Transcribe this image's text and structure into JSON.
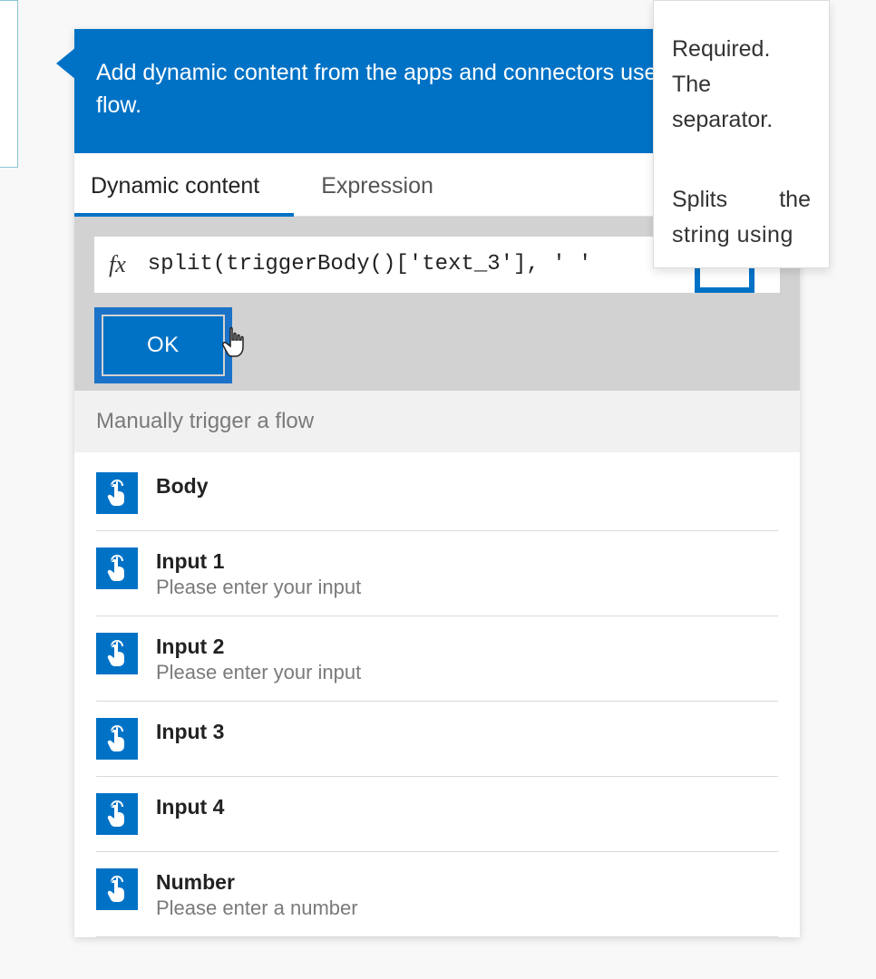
{
  "colors": {
    "primary": "#0072c6"
  },
  "header": {
    "text": "Add dynamic content from the apps and connectors used in this flow."
  },
  "tabs": [
    {
      "label": "Dynamic content",
      "active": true
    },
    {
      "label": "Expression",
      "active": false
    }
  ],
  "expression": {
    "fx_label": "fx",
    "value": "split(triggerBody()['text_3'], ' '",
    "ok_label": "OK"
  },
  "tooltip": {
    "line1": "Required. The separator.",
    "line2a": "Splits",
    "line2b": "the",
    "line3": "string using"
  },
  "section": {
    "title": "Manually trigger a flow"
  },
  "items": [
    {
      "title": "Body",
      "desc": ""
    },
    {
      "title": "Input 1",
      "desc": "Please enter your input"
    },
    {
      "title": "Input 2",
      "desc": "Please enter your input"
    },
    {
      "title": "Input 3",
      "desc": ""
    },
    {
      "title": "Input 4",
      "desc": ""
    },
    {
      "title": "Number",
      "desc": "Please enter a number"
    }
  ]
}
